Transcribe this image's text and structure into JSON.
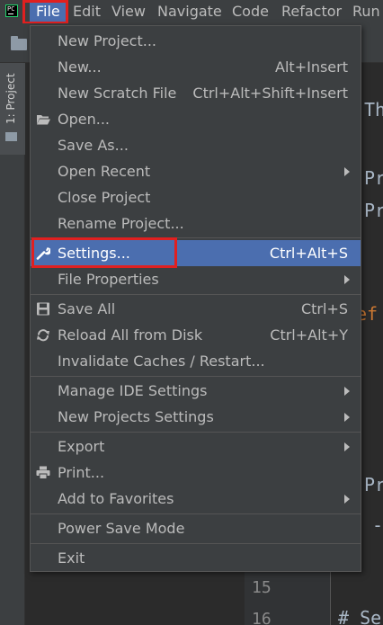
{
  "menubar": {
    "app_icon_text": "PC",
    "items": [
      "File",
      "Edit",
      "View",
      "Navigate",
      "Code",
      "Refactor",
      "Run"
    ]
  },
  "sidebar": {
    "project_tab": "1: Project"
  },
  "editor": {
    "line_numbers": [
      "15",
      "16"
    ],
    "code_fragments": [
      "Th",
      "Pr",
      "Pr",
      "ef",
      "Pr",
      "-",
      "# Se"
    ]
  },
  "file_menu": {
    "items": {
      "new_project": {
        "label": "New Project..."
      },
      "new": {
        "label": "New...",
        "shortcut": "Alt+Insert"
      },
      "new_scratch": {
        "label": "New Scratch File",
        "shortcut": "Ctrl+Alt+Shift+Insert"
      },
      "open": {
        "label": "Open...",
        "icon": "open-folder-icon"
      },
      "save_as": {
        "label": "Save As..."
      },
      "open_recent": {
        "label": "Open Recent"
      },
      "close_project": {
        "label": "Close Project"
      },
      "rename_project": {
        "label": "Rename Project..."
      },
      "settings": {
        "label": "Settings...",
        "shortcut": "Ctrl+Alt+S",
        "icon": "wrench-icon"
      },
      "file_properties": {
        "label": "File Properties"
      },
      "save_all": {
        "label": "Save All",
        "shortcut": "Ctrl+S",
        "icon": "floppy-icon"
      },
      "reload": {
        "label": "Reload All from Disk",
        "shortcut": "Ctrl+Alt+Y",
        "icon": "reload-icon"
      },
      "invalidate": {
        "label": "Invalidate Caches / Restart..."
      },
      "manage_ide": {
        "label": "Manage IDE Settings"
      },
      "new_projects_settings": {
        "label": "New Projects Settings"
      },
      "export": {
        "label": "Export"
      },
      "print": {
        "label": "Print...",
        "icon": "printer-icon"
      },
      "add_favorites": {
        "label": "Add to Favorites"
      },
      "power_save": {
        "label": "Power Save Mode"
      },
      "exit": {
        "label": "Exit"
      }
    }
  },
  "colors": {
    "menu_bg": "#3c3f41",
    "selection": "#4b6eaf",
    "highlight_box": "#e02020",
    "text": "#bbbbbb"
  }
}
